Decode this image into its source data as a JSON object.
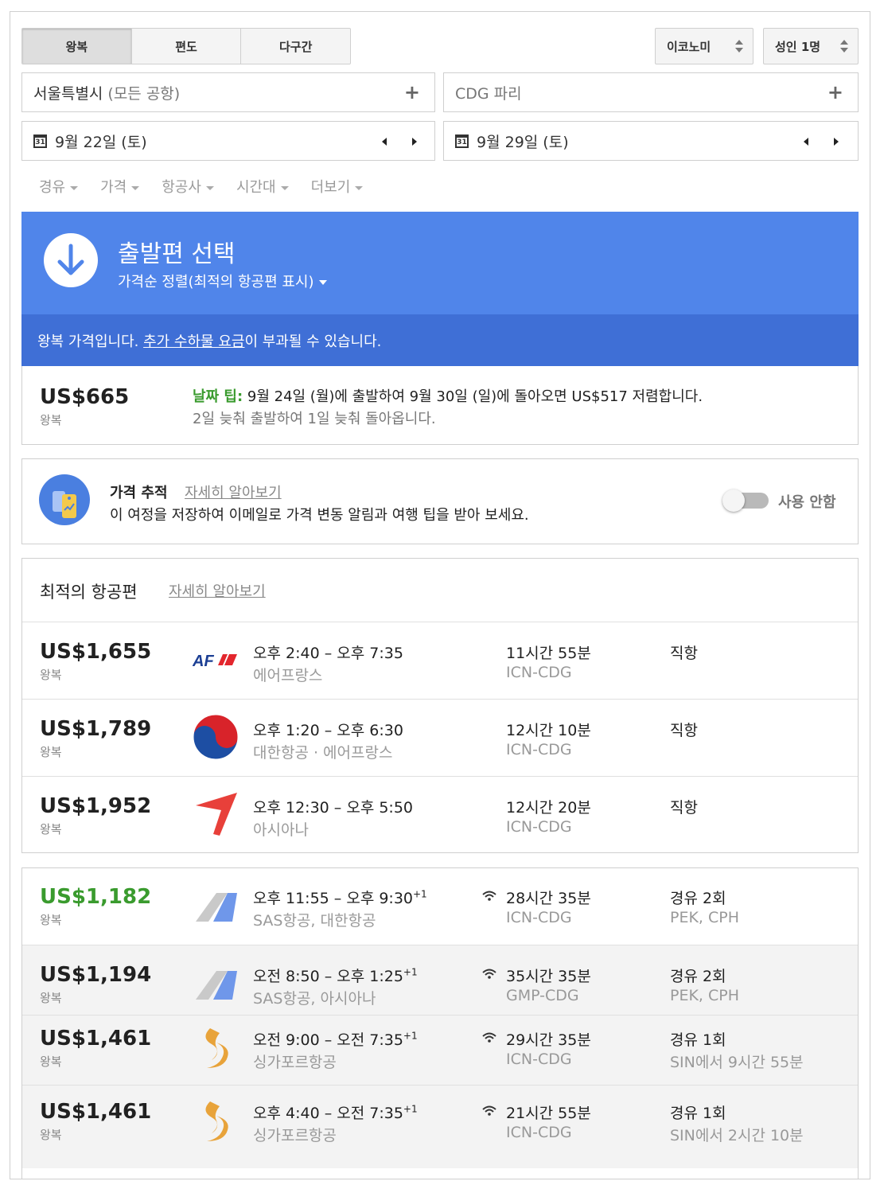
{
  "trip_types": [
    "왕복",
    "편도",
    "다구간"
  ],
  "cabin": "이코노미",
  "passengers": "성인 1명",
  "origin": {
    "name": "서울특별시",
    "detail": "(모든 공항)"
  },
  "destination": {
    "name": "CDG 파리"
  },
  "depart_date": "9월 22일 (토)",
  "return_date": "9월 29일 (토)",
  "calendar_icon_text": "31",
  "filters": [
    "경유",
    "가격",
    "항공사",
    "시간대",
    "더보기"
  ],
  "banner": {
    "title": "출발편 선택",
    "sort": "가격순 정렬(최적의 항공편 표시)"
  },
  "notice": {
    "before": "왕복 가격입니다. ",
    "link": "추가 수하물 요금",
    "after": "이 부과될 수 있습니다."
  },
  "date_tip": {
    "price": "US$665",
    "price_label": "왕복",
    "tip_label": "날짜 팁:",
    "tip_text": " 9월 24일 (월)에 출발하여 9월 30일 (일)에 돌아오면 US$517 저렴합니다.",
    "tip_sub": "2일 늦춰 출발하여 1일 늦춰 돌아옵니다."
  },
  "price_tracking": {
    "title": "가격 추적",
    "learn_more": "자세히 알아보기",
    "desc": "이 여정을 저장하여 이메일로 가격 변동 알림과 여행 팁을 받아 보세요.",
    "toggle_label": "사용 안함"
  },
  "best_flights": {
    "title": "최적의 항공편",
    "learn_more": "자세히 알아보기",
    "rows": [
      {
        "price": "US$1,655",
        "type": "왕복",
        "logo": "air-france-logo-icon",
        "time": "오후 2:40 – 오후 7:35",
        "sup": "",
        "airline": "에어프랑스",
        "duration": "11시간 55분",
        "route": "ICN-CDG",
        "stops": "직항",
        "stop_detail": ""
      },
      {
        "price": "US$1,789",
        "type": "왕복",
        "logo": "korean-air-logo-icon",
        "time": "오후 1:20 – 오후 6:30",
        "sup": "",
        "airline": "대한항공 · 에어프랑스",
        "duration": "12시간 10분",
        "route": "ICN-CDG",
        "stops": "직항",
        "stop_detail": ""
      },
      {
        "price": "US$1,952",
        "type": "왕복",
        "logo": "asiana-logo-icon",
        "time": "오후 12:30 – 오후 5:50",
        "sup": "",
        "airline": "아시아나",
        "duration": "12시간 20분",
        "route": "ICN-CDG",
        "stops": "직항",
        "stop_detail": ""
      }
    ]
  },
  "other_flights": [
    {
      "price": "US$1,182",
      "type": "왕복",
      "logo": "multi-airline-logo-icon",
      "time": "오후 11:55 – 오후 9:30",
      "sup": "+1",
      "airline": "SAS항공, 대한항공",
      "duration": "28시간 35분",
      "route": "ICN-CDG",
      "stops": "경유 2회",
      "stop_detail": "PEK, CPH"
    },
    {
      "price": "US$1,194",
      "type": "왕복",
      "logo": "multi-airline-logo-icon",
      "time": "오전 8:50 – 오후 1:25",
      "sup": "+1",
      "airline": "SAS항공, 아시아나",
      "duration": "35시간 35분",
      "route": "GMP-CDG",
      "stops": "경유 2회",
      "stop_detail": "PEK, CPH"
    },
    {
      "price": "US$1,461",
      "type": "왕복",
      "logo": "singapore-airlines-logo-icon",
      "time": "오전 9:00 – 오전 7:35",
      "sup": "+1",
      "airline": "싱가포르항공",
      "duration": "29시간 35분",
      "route": "ICN-CDG",
      "stops": "경유 1회",
      "stop_detail": "SIN에서 9시간 55분"
    },
    {
      "price": "US$1,461",
      "type": "왕복",
      "logo": "singapore-airlines-logo-icon",
      "time": "오후 4:40 – 오전 7:35",
      "sup": "+1",
      "airline": "싱가포르항공",
      "duration": "21시간 55분",
      "route": "ICN-CDG",
      "stops": "경유 1회",
      "stop_detail": "SIN에서 2시간 10분"
    }
  ],
  "colors": {
    "banner": "#5085ea",
    "notice": "#3f6fd6",
    "tip_green": "#3a9b2e",
    "asiana_red": "#e8403a",
    "singapore_gold": "#e8a33a",
    "sas_blue": "#6f97ea"
  }
}
